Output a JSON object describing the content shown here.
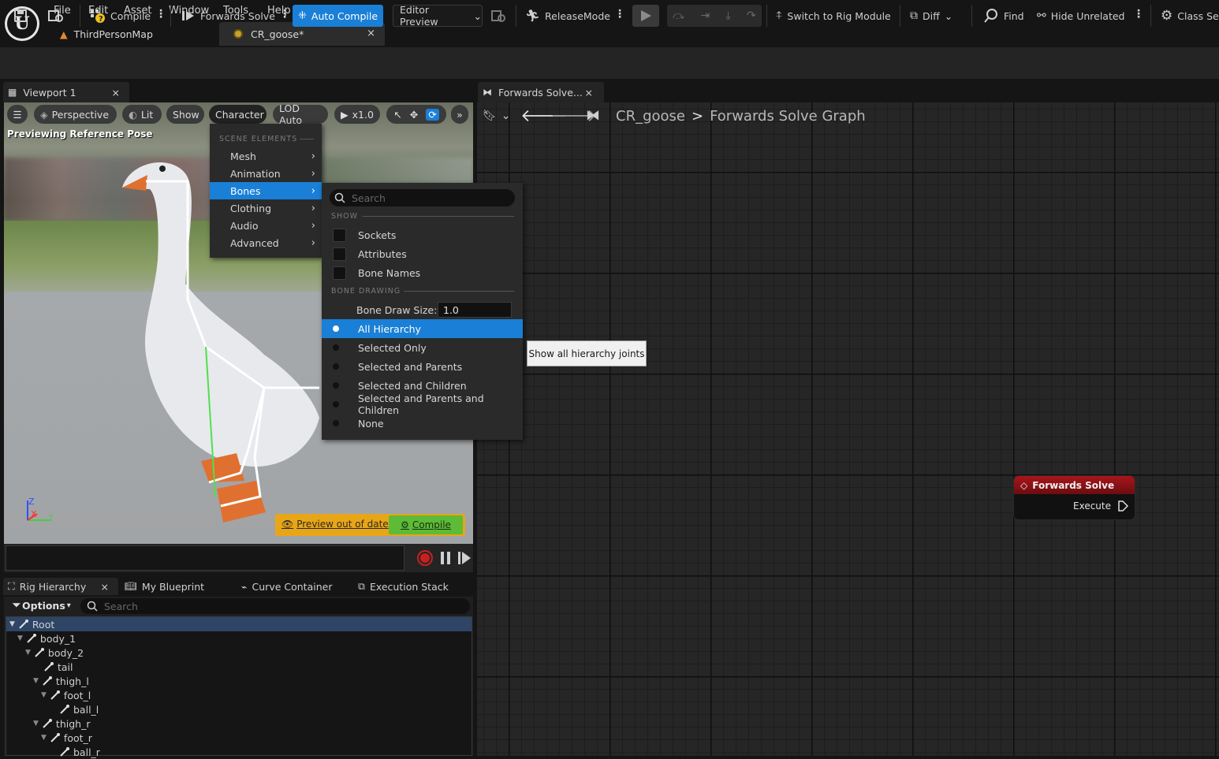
{
  "menubar": {
    "items": [
      "File",
      "Edit",
      "Asset",
      "Window",
      "Tools",
      "Help"
    ]
  },
  "doc_tabs": {
    "map": "ThirdPersonMap",
    "asset": "CR_goose*",
    "close": "×"
  },
  "toolbar": {
    "compile": "Compile",
    "forwards_solve": "Forwards Solve",
    "auto_compile": "Auto Compile",
    "editor_preview": "Editor Preview",
    "release_mode": "ReleaseMode",
    "switch_rig": "Switch to Rig Module",
    "diff": "Diff",
    "find": "Find",
    "hide_unrelated": "Hide Unrelated",
    "class_settings": "Class Se"
  },
  "viewport": {
    "tab_label": "Viewport 1",
    "perspective": "Perspective",
    "lit": "Lit",
    "show": "Show",
    "character": "Character",
    "lod": "LOD Auto",
    "speed": "x1.0",
    "previewing": "Previewing Reference Pose",
    "preview_out": "Preview out of date",
    "compile": "Compile",
    "axis_z": "Z",
    "axis_x": "X",
    "axis_y": "Y"
  },
  "character_menu": {
    "header": "SCENE ELEMENTS",
    "items": [
      "Mesh",
      "Animation",
      "Bones",
      "Clothing",
      "Audio",
      "Advanced"
    ],
    "highlighted": "Bones"
  },
  "bones_menu": {
    "search_placeholder": "Search",
    "show_header": "SHOW",
    "checkboxes": [
      "Sockets",
      "Attributes",
      "Bone Names"
    ],
    "drawing_header": "BONE DRAWING",
    "draw_size_label": "Bone Draw Size:",
    "draw_size_value": "1.0",
    "options": [
      "All Hierarchy",
      "Selected Only",
      "Selected and Parents",
      "Selected and Children",
      "Selected and Parents and Children",
      "None"
    ],
    "selected": "All Hierarchy"
  },
  "tooltip": "Show all hierarchy joints",
  "lower_tabs": {
    "rig_hierarchy": "Rig Hierarchy",
    "my_blueprint": "My Blueprint",
    "curve_container": "Curve Container",
    "execution_stack": "Execution Stack"
  },
  "rig": {
    "options": "Options",
    "search_placeholder": "Search",
    "tree": [
      "Root",
      "body_1",
      "body_2",
      "tail",
      "thigh_l",
      "foot_l",
      "ball_l",
      "thigh_r",
      "foot_r",
      "ball_r"
    ]
  },
  "graph": {
    "tab_label": "Forwards Solve...",
    "breadcrumb_root": "CR_goose",
    "breadcrumb_sep": ">",
    "breadcrumb_graph": "Forwards Solve Graph",
    "node_title": "Forwards Solve",
    "node_pin": "Execute"
  },
  "colors": {
    "accent": "#1a7fd6",
    "warning": "#e8a617",
    "compile_green": "#5dbb38",
    "node_header": "#a8151a"
  }
}
